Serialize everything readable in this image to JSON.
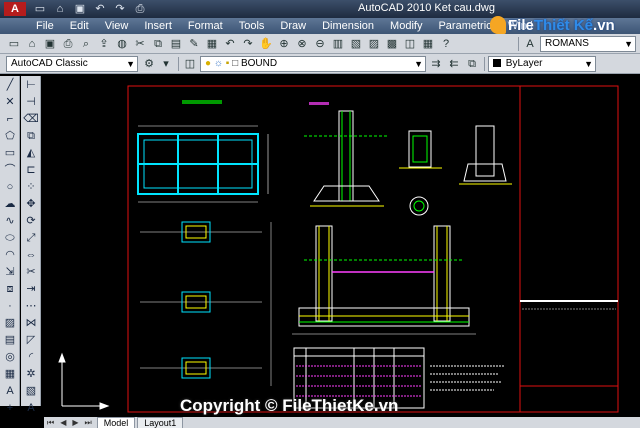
{
  "app": {
    "logo_letter": "A",
    "title": "AutoCAD 2010     Ket cau.dwg"
  },
  "menu": [
    "File",
    "Edit",
    "View",
    "Insert",
    "Format",
    "Tools",
    "Draw",
    "Dimension",
    "Modify",
    "Parametric",
    "Wind"
  ],
  "brand": {
    "part1": "File",
    "part2": "Thiết Kế",
    "part3": ".vn"
  },
  "toolbar": {
    "text_style": "ROMANS",
    "workspace": "AutoCAD Classic",
    "layer": "BOUND",
    "color": "ByLayer"
  },
  "tabs": {
    "model": "Model",
    "layout1": "Layout1"
  },
  "watermark": "Copyright © FileThietKe.vn",
  "colors": {
    "canvas": "#000000",
    "frame": "#e01010",
    "cyan": "#00e5ff",
    "yellow": "#ffff00",
    "magenta": "#ff40ff",
    "green": "#00ff00",
    "white": "#ffffff"
  }
}
